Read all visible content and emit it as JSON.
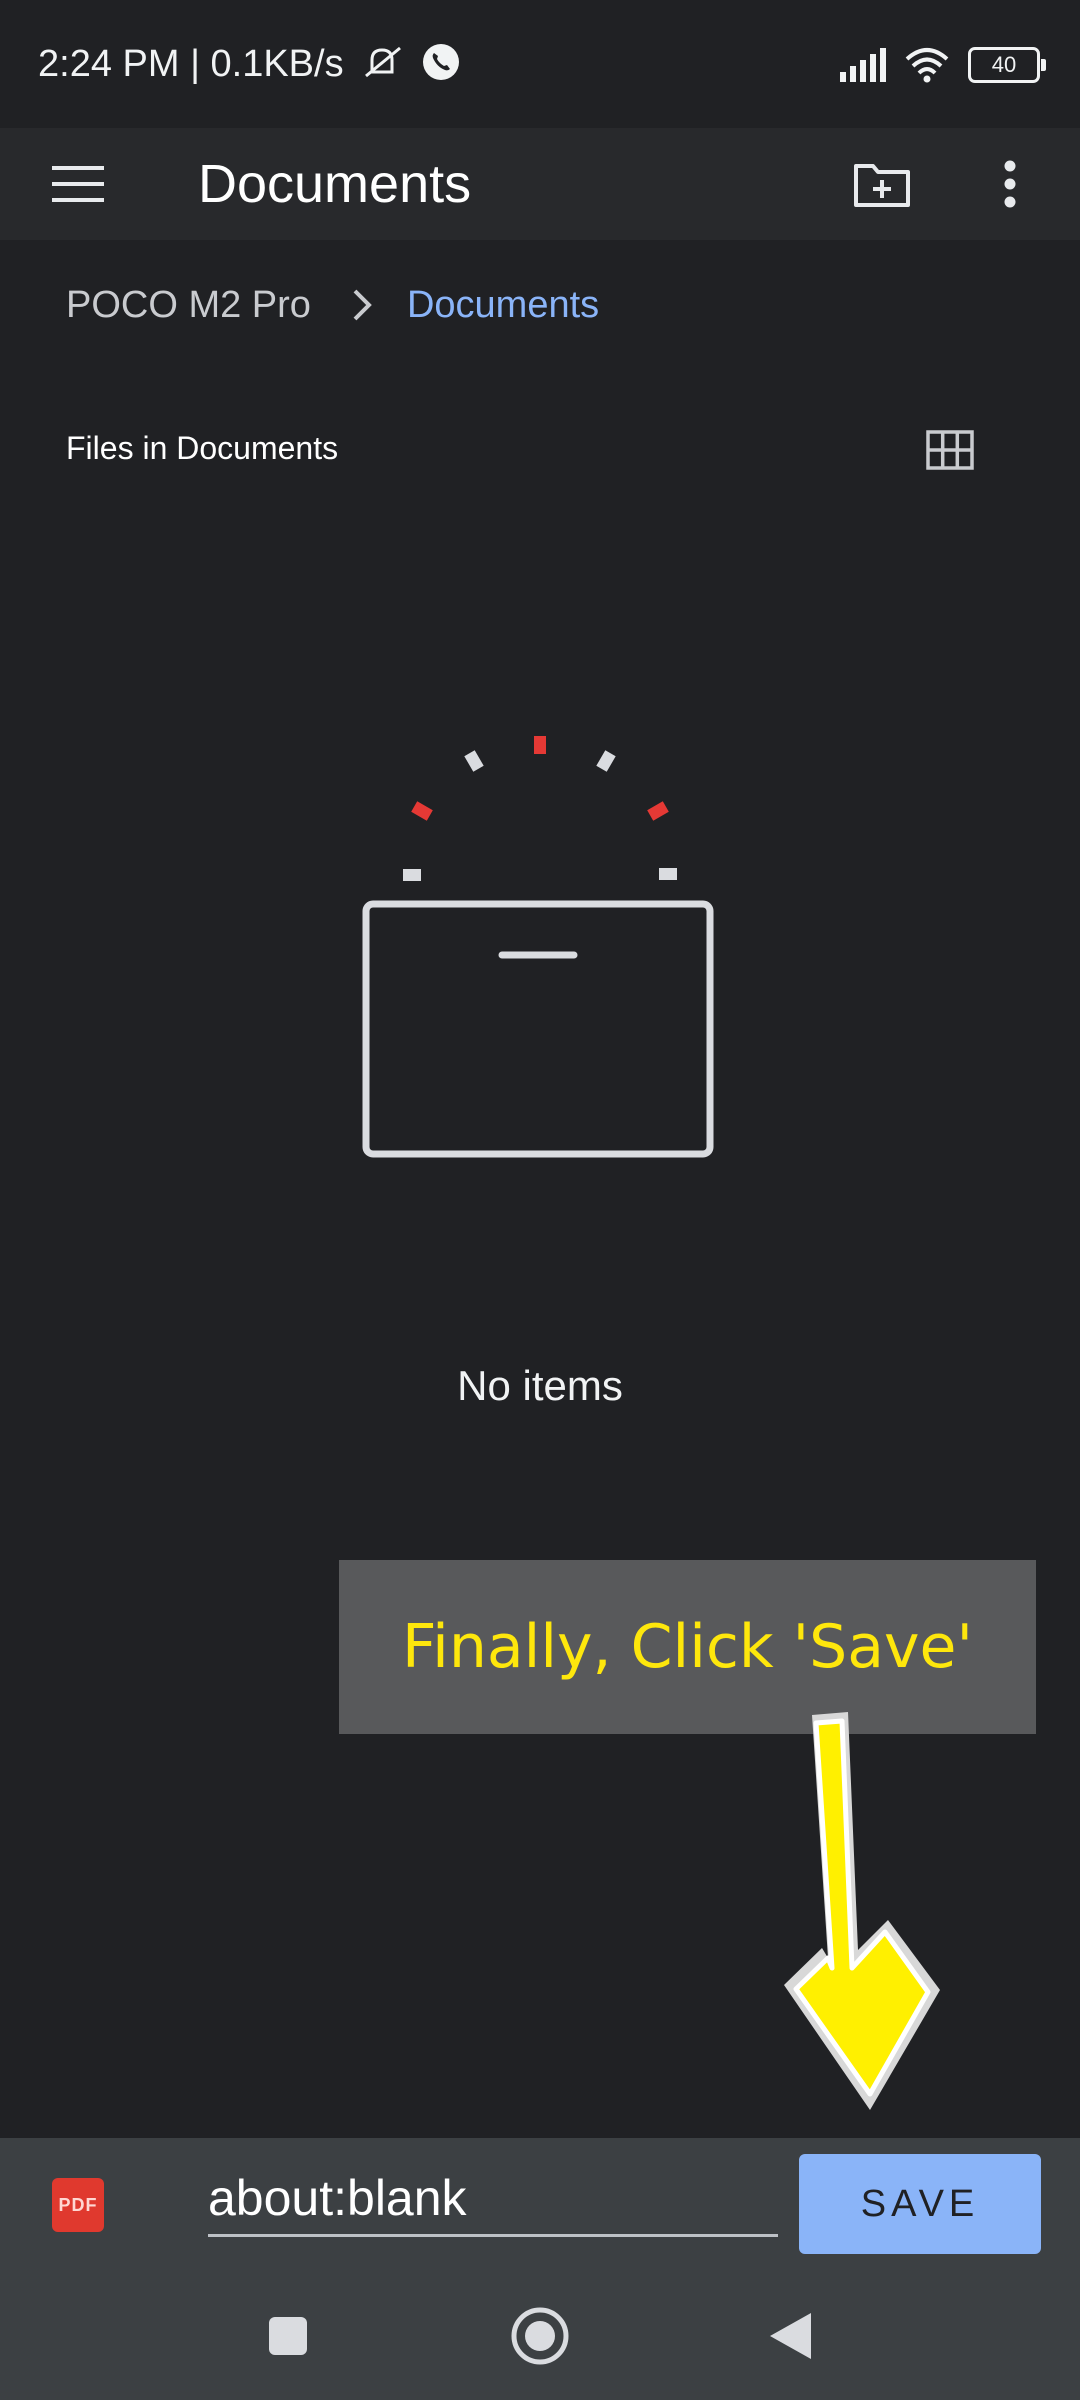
{
  "status_bar": {
    "time_and_speed": "2:24 PM | 0.1KB/s",
    "battery": "40"
  },
  "app_bar": {
    "title": "Documents",
    "icons": [
      "menu-icon",
      "new-folder-icon",
      "more-vert-icon"
    ]
  },
  "breadcrumb": {
    "root": "POCO M2 Pro",
    "current": "Documents"
  },
  "section": {
    "title": "Files in Documents"
  },
  "empty_state": {
    "text": "No items"
  },
  "annotation": {
    "text": "Finally, Click 'Save'"
  },
  "save_bar": {
    "file_type": "PDF",
    "filename": "about:blank",
    "save_label": "SAVE"
  },
  "nav_bar": {
    "icons": [
      "recents-icon",
      "home-icon",
      "back-icon"
    ]
  },
  "colors": {
    "background": "#202124",
    "app_bar": "#28292c",
    "accent": "#8ab4f8",
    "annotation_text": "#fee70c",
    "pdf_badge": "#e0392e",
    "illustration_red": "#e53935"
  }
}
